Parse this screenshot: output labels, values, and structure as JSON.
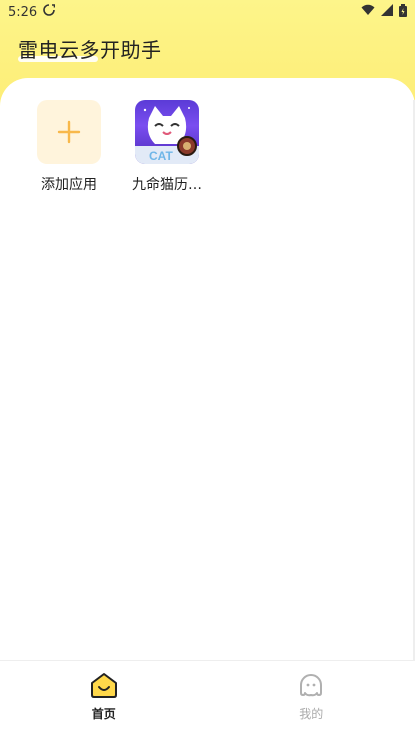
{
  "status_bar": {
    "time": "5:26",
    "sync_icon": "sync-icon",
    "wifi_icon": "wifi-icon",
    "signal_icon": "signal-icon",
    "battery_icon": "battery-icon"
  },
  "header": {
    "title": "雷电云多开助手"
  },
  "apps": [
    {
      "label": "添加应用",
      "icon": "plus-icon"
    },
    {
      "label": "九命猫历…",
      "icon": "cat-game-icon"
    }
  ],
  "bottom_nav": {
    "home_label": "首页",
    "mine_label": "我的"
  },
  "colors": {
    "header_yellow": "#fdf58a",
    "accent": "#f8b84a"
  }
}
